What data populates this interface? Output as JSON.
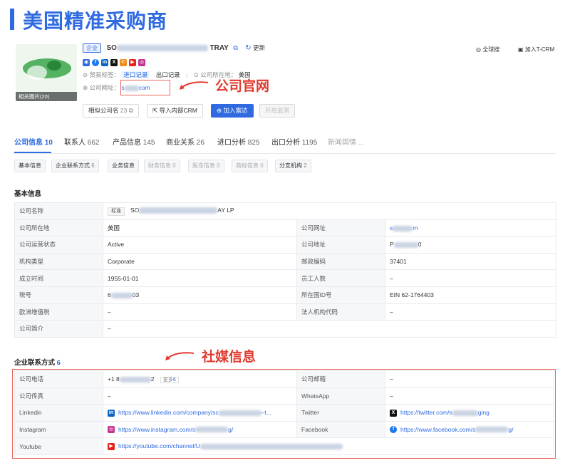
{
  "page_title": "美国精准采购商",
  "company": {
    "type_tag": "企业",
    "name_visible_start": "SO",
    "name_visible_end": "TRAY",
    "update_label": "更新",
    "photo_caption": "相关图片(20)",
    "trade_tags_label": "贸易标签：",
    "trade_tags": [
      "进口记录",
      "出口记录"
    ],
    "location_label": "公司所在地：",
    "location": "美国",
    "website_label": "公司网址：",
    "website_visible_start": "s",
    "website_visible_end": "com",
    "global_search": "全球搜",
    "add_crm": "加入T-CRM"
  },
  "social_icons": [
    "website-icon",
    "facebook-icon",
    "linkedin-icon",
    "x-icon",
    "phone-icon",
    "youtube-icon",
    "instagram-icon"
  ],
  "buttons": {
    "similar_label": "相似公司名",
    "similar_count": "23",
    "import_crm": "导入内部CRM",
    "add_radar": "加入雷达",
    "start_monitor": "开启监测"
  },
  "annotations": {
    "official_site": "公司官网",
    "social_info": "社媒信息"
  },
  "tabs": [
    {
      "label": "公司信息",
      "count": "10"
    },
    {
      "label": "联系人",
      "count": "662"
    },
    {
      "label": "产品信息",
      "count": "145"
    },
    {
      "label": "商业关系",
      "count": "26"
    },
    {
      "label": "进口分析",
      "count": "825"
    },
    {
      "label": "出口分析",
      "count": "1195"
    },
    {
      "label": "新闻舆情",
      "count": "..."
    }
  ],
  "subtabs": [
    {
      "label": "基本信息",
      "count": ""
    },
    {
      "label": "企业联系方式",
      "count": "6"
    },
    {
      "label": "业务信息",
      "count": ""
    },
    {
      "label": "财务信息",
      "count": "0"
    },
    {
      "label": "股东信息",
      "count": "0"
    },
    {
      "label": "商标信息",
      "count": "0"
    },
    {
      "label": "分支机构",
      "count": "2"
    }
  ],
  "basic_info": {
    "title": "基本信息",
    "name_label": "公司名称",
    "name_tag": "标准",
    "name_visible_start": "SO",
    "name_visible_end": "AY LP",
    "rows": [
      {
        "k1": "公司所在地",
        "v1": "美国",
        "k2": "公司网址",
        "v2": "s",
        "v2_end": "m"
      },
      {
        "k1": "公司运营状态",
        "v1": "Active",
        "k2": "公司地址",
        "v2": "P",
        "v2_end": "0"
      },
      {
        "k1": "机构类型",
        "v1": "Corporate",
        "k2": "邮政编码",
        "v2": "37401",
        "v2_end": ""
      },
      {
        "k1": "成立时间",
        "v1": "1955-01-01",
        "k2": "员工人数",
        "v2": "–",
        "v2_end": ""
      },
      {
        "k1": "税号",
        "v1": "6",
        "v1_end": "03",
        "k2": "所在国ID号",
        "v2": "EIN 62-1764403",
        "v2_end": ""
      },
      {
        "k1": "欧洲增值税",
        "v1": "–",
        "k2": "法人机构代码",
        "v2": "–",
        "v2_end": ""
      }
    ],
    "intro_label": "公司简介",
    "intro_value": "–"
  },
  "contact": {
    "title": "企业联系方式",
    "count": "6",
    "phone_label": "公司电话",
    "phone_start": "+1 8",
    "phone_end": "2",
    "more_label": "更多",
    "more_count": "6",
    "email_label": "公司邮箱",
    "email_value": "–",
    "fax_label": "公司传真",
    "fax_value": "–",
    "whatsapp_label": "WhatsApp",
    "whatsapp_value": "–",
    "linkedin_label": "Linkedin",
    "linkedin_url": "https://www.linkedin.com/company/sc",
    "linkedin_tail": "–t...",
    "twitter_label": "Twitter",
    "twitter_url": "https://twitter.com/s",
    "twitter_tail": "ging",
    "instagram_label": "Instagram",
    "instagram_url": "https://www.instagram.com/s",
    "instagram_tail": "g/",
    "facebook_label": "Facebook",
    "facebook_url": "https://www.facebook.com/s",
    "facebook_tail": "g/",
    "youtube_label": "Youtube",
    "youtube_url": "https://youtube.com/channel/U"
  },
  "colors": {
    "accent": "#2f6ae0",
    "annotation_red": "#e03a2f"
  }
}
